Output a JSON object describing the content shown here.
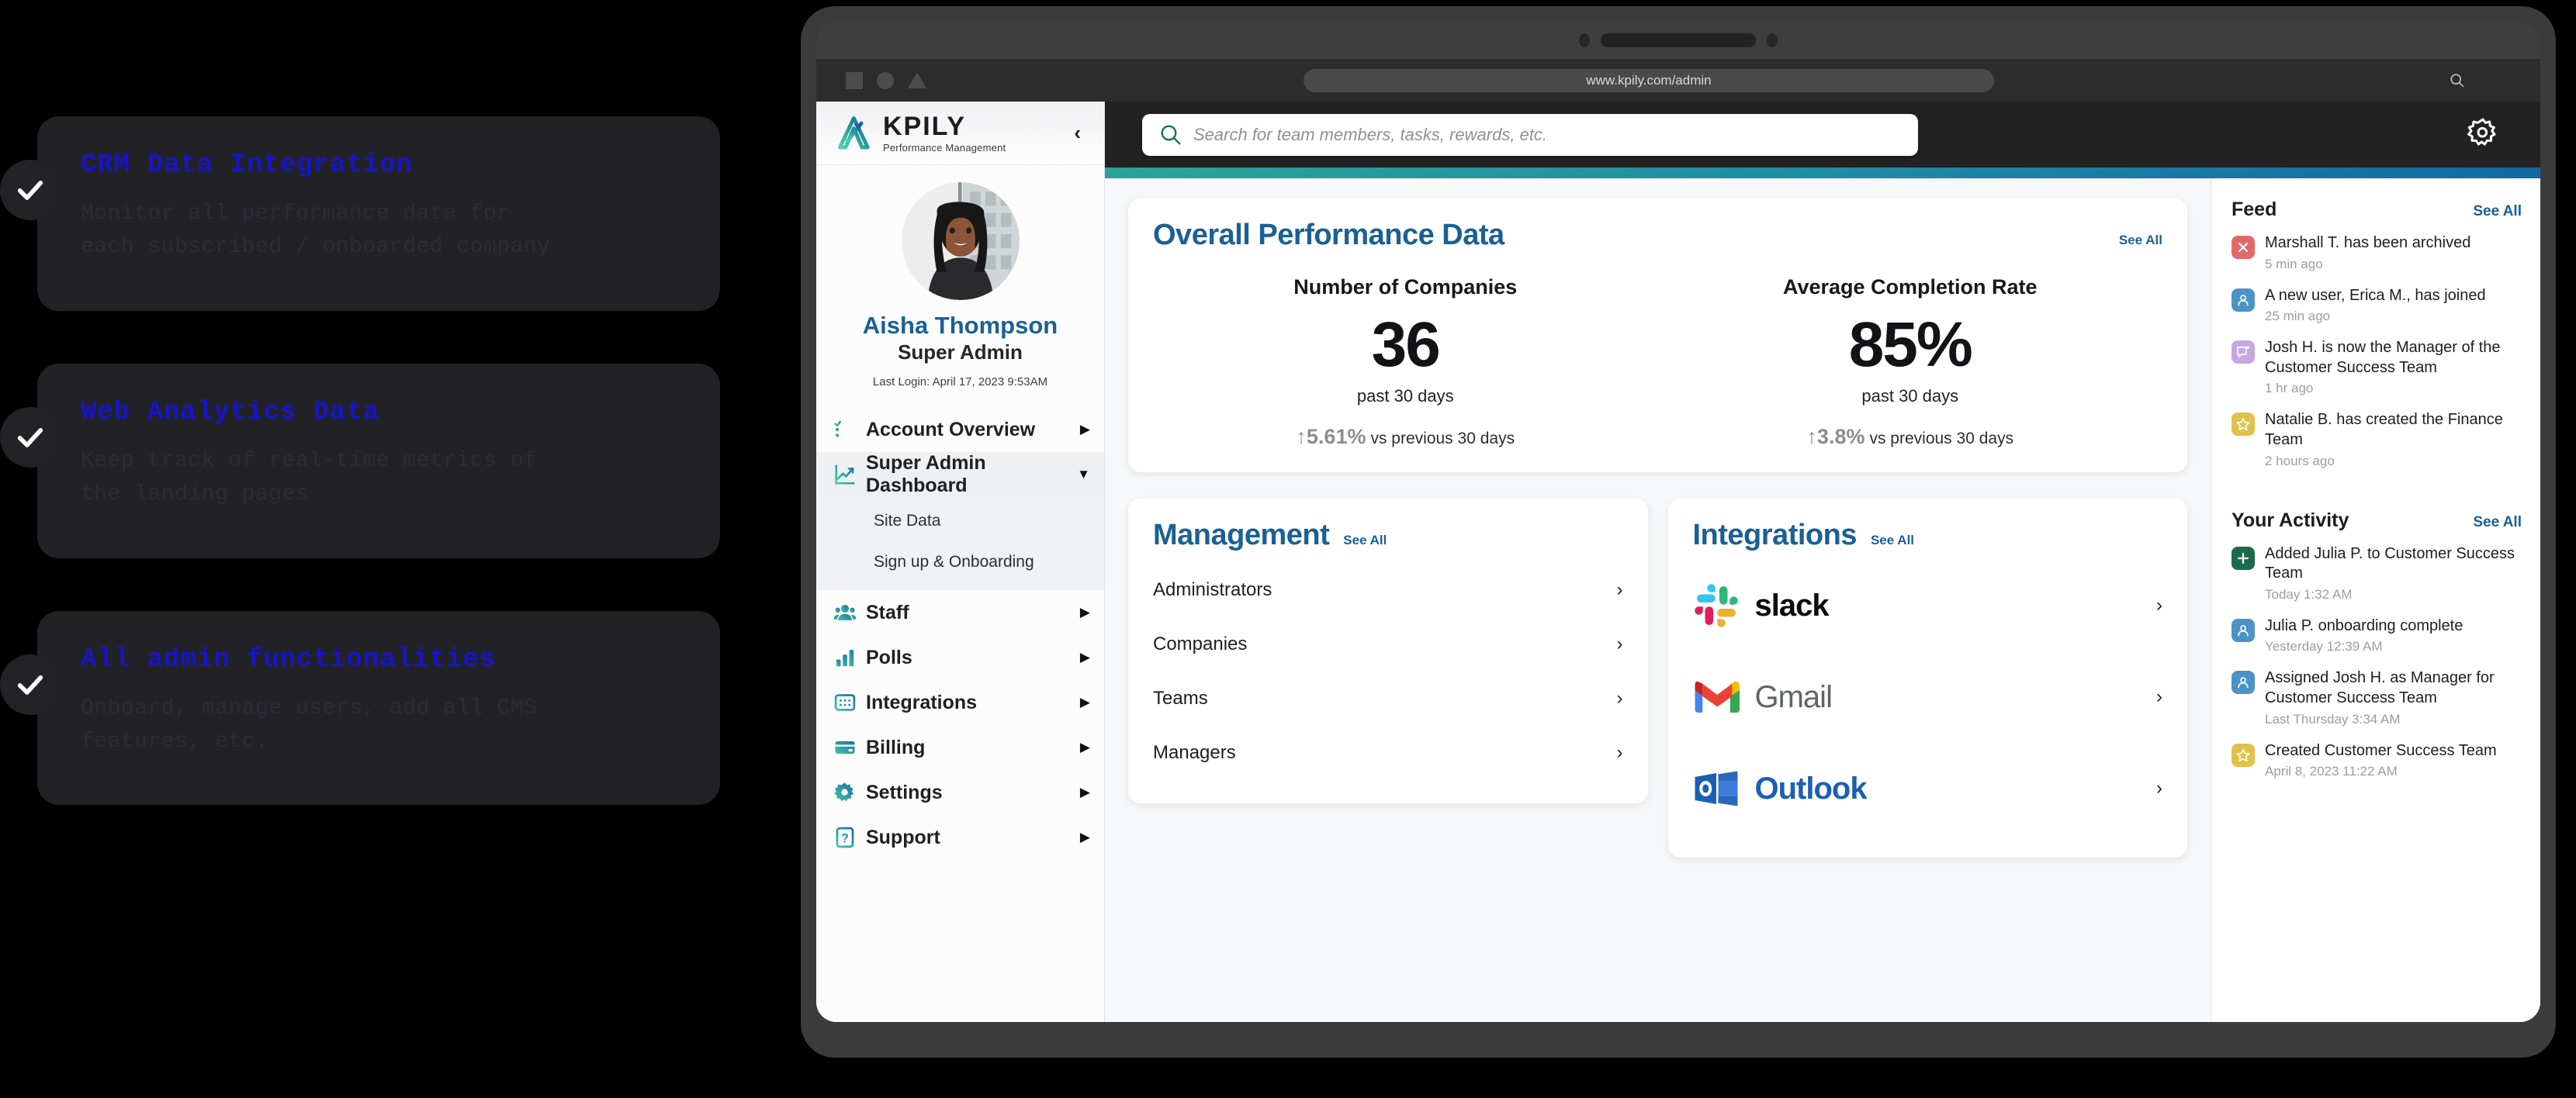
{
  "features": [
    {
      "title": "CRM Data Integration",
      "desc": "Monitor all performance data for\neach subscribed / onboarded company"
    },
    {
      "title": "Web Analytics Data",
      "desc": "Keep track of real-time metrics of\nthe landing pages"
    },
    {
      "title": "All admin functionalities",
      "desc": "Onboard, manage users, add all CMS\nfeatures, etc."
    }
  ],
  "browser": {
    "url": "www.kpily.com/admin"
  },
  "sidebar": {
    "brand_name": "KPILY",
    "brand_tagline": "Performance Management",
    "collapse_label": "‹",
    "profile": {
      "name": "Aisha Thompson",
      "role": "Super Admin",
      "last_login": "Last Login: April 17, 2023 9:53AM"
    },
    "nav": [
      {
        "label": "Account Overview",
        "icon": "checklist-icon",
        "arrow": "▶",
        "active": false
      },
      {
        "label": "Super Admin Dashboard",
        "icon": "line-chart-icon",
        "arrow": "▼",
        "active": true
      },
      {
        "label": "Staff",
        "icon": "people-icon",
        "arrow": "▶",
        "active": false
      },
      {
        "label": "Polls",
        "icon": "bar-chart-icon",
        "arrow": "▶",
        "active": false
      },
      {
        "label": "Integrations",
        "icon": "grid-icon",
        "arrow": "▶",
        "active": false
      },
      {
        "label": "Billing",
        "icon": "card-icon",
        "arrow": "▶",
        "active": false
      },
      {
        "label": "Settings",
        "icon": "gear-icon",
        "arrow": "▶",
        "active": false
      },
      {
        "label": "Support",
        "icon": "question-icon",
        "arrow": "▶",
        "active": false
      }
    ],
    "sub_items": [
      {
        "label": "Site Data"
      },
      {
        "label": "Sign up & Onboarding"
      }
    ]
  },
  "topbar": {
    "search_placeholder": "Search for team members, tasks, rewards, etc.",
    "search_icon": "search-icon",
    "settings_icon": "gear-icon"
  },
  "performance": {
    "title": "Overall Performance Data",
    "see_all": "See All",
    "kpis": [
      {
        "label": "Number of Companies",
        "value": "36",
        "period": "past 30 days",
        "delta": "↑5.61%",
        "delta_note": "vs previous 30 days"
      },
      {
        "label": "Average Completion Rate",
        "value": "85%",
        "period": "past 30 days",
        "delta": "↑3.8%",
        "delta_note": "vs previous 30 days"
      }
    ]
  },
  "management": {
    "title": "Management",
    "see_all": "See All",
    "items": [
      {
        "label": "Administrators",
        "chevron": "›"
      },
      {
        "label": "Companies",
        "chevron": "›"
      },
      {
        "label": "Teams",
        "chevron": "›"
      },
      {
        "label": "Managers",
        "chevron": "›"
      }
    ]
  },
  "integrations": {
    "title": "Integrations",
    "see_all": "See All",
    "items": [
      {
        "label": "slack",
        "logo": "slack-logo",
        "chevron": "›"
      },
      {
        "label": "Gmail",
        "logo": "gmail-logo",
        "chevron": "›"
      },
      {
        "label": "Outlook",
        "logo": "outlook-logo",
        "chevron": "›"
      }
    ]
  },
  "feed": {
    "title": "Feed",
    "see_all": "See All",
    "items": [
      {
        "text": "Marshall T. has been archived",
        "time": "5 min ago",
        "icon": "close-icon",
        "color": "#e06a6a"
      },
      {
        "text": "A new user, Erica M., has joined",
        "time": "25 min ago",
        "icon": "user-icon",
        "color": "#4b93c4"
      },
      {
        "text": "Josh H. is now the Manager of the Customer Success Team",
        "time": "1 hr ago",
        "icon": "message-icon",
        "color": "#c6a7df"
      },
      {
        "text": "Natalie B. has created the Finance Team",
        "time": "2 hours ago",
        "icon": "star-icon",
        "color": "#e2c14a"
      }
    ]
  },
  "activity": {
    "title": "Your Activity",
    "see_all": "See All",
    "items": [
      {
        "text": "Added Julia P. to Customer Success Team",
        "time": "Today 1:32 AM",
        "icon": "plus-icon",
        "color": "#1b6b4b"
      },
      {
        "text": "Julia P. onboarding complete",
        "time": "Yesterday 12:39 AM",
        "icon": "user-icon",
        "color": "#4b93c4"
      },
      {
        "text": "Assigned Josh H. as Manager for Customer Success Team",
        "time": "Last Thursday 3:34 AM",
        "icon": "user-icon",
        "color": "#4b93c4"
      },
      {
        "text": "Created Customer Success Team",
        "time": "April 8, 2023 11:22 AM",
        "icon": "star-icon",
        "color": "#e2c14a"
      }
    ]
  },
  "colors": {
    "brand_blue": "#1a6095",
    "accent_teal": "#29a498",
    "accent_blue": "#1269a2",
    "feature_title": "#1414c8",
    "card_bg": "#222226"
  }
}
